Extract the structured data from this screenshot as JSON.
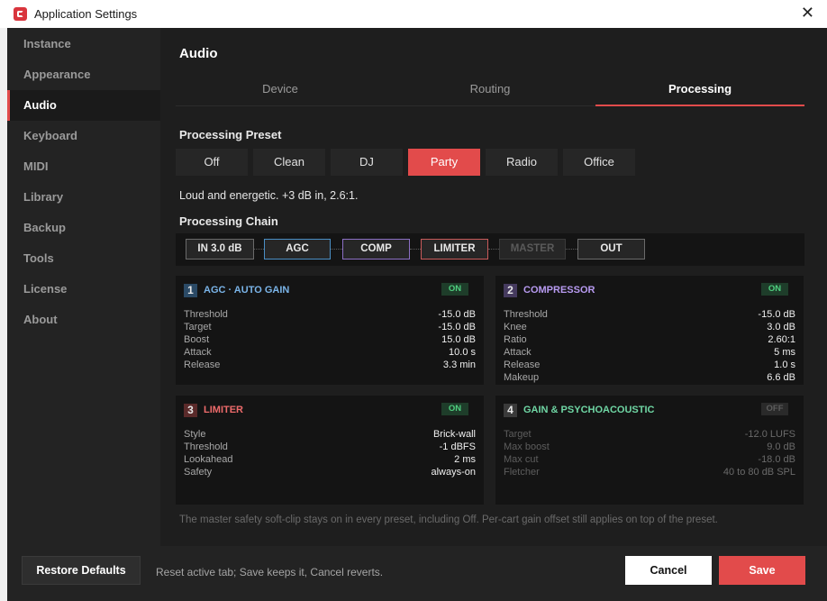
{
  "window": {
    "title": "Application Settings",
    "icon": "app-logo-icon",
    "close_glyph": "✕"
  },
  "sidebar": {
    "items": [
      {
        "label": "Instance"
      },
      {
        "label": "Appearance"
      },
      {
        "label": "Audio",
        "active": true
      },
      {
        "label": "Keyboard"
      },
      {
        "label": "MIDI"
      },
      {
        "label": "Library"
      },
      {
        "label": "Backup"
      },
      {
        "label": "Tools"
      },
      {
        "label": "License"
      },
      {
        "label": "About"
      }
    ]
  },
  "main": {
    "title": "Audio",
    "tabs": [
      {
        "label": "Device"
      },
      {
        "label": "Routing"
      },
      {
        "label": "Processing",
        "active": true
      }
    ],
    "preset_label": "Processing Preset",
    "presets": [
      {
        "label": "Off"
      },
      {
        "label": "Clean"
      },
      {
        "label": "DJ"
      },
      {
        "label": "Party",
        "active": true
      },
      {
        "label": "Radio"
      },
      {
        "label": "Office"
      }
    ],
    "preset_description": "Loud and energetic. +3 dB in, 2.6:1.",
    "chain_label": "Processing Chain",
    "chain": [
      {
        "label": "IN 3.0 dB",
        "border": "#6a6a6a",
        "color": "#e8e8e8"
      },
      {
        "label": "AGC",
        "border": "#4a8ec4",
        "color": "#e8e8e8"
      },
      {
        "label": "COMP",
        "border": "#8b6fc4",
        "color": "#e8e8e8"
      },
      {
        "label": "LIMITER",
        "border": "#c85a5a",
        "color": "#e8e8e8"
      },
      {
        "label": "MASTER",
        "border": "#3a3a3a",
        "color": "#5a5a5a"
      },
      {
        "label": "OUT",
        "border": "#6a6a6a",
        "color": "#e8e8e8"
      }
    ],
    "cards": [
      {
        "num": "1",
        "title": "AGC · AUTO GAIN",
        "title_color": "#7ab4e8",
        "num_bg": "#2b4a66",
        "toggle": "ON",
        "enabled": true,
        "rows": [
          {
            "k": "Threshold",
            "v": "-15.0 dB"
          },
          {
            "k": "Target",
            "v": "-15.0 dB"
          },
          {
            "k": "Boost",
            "v": "15.0 dB"
          },
          {
            "k": "Attack",
            "v": "10.0 s"
          },
          {
            "k": "Release",
            "v": "3.3 min"
          }
        ]
      },
      {
        "num": "2",
        "title": "COMPRESSOR",
        "title_color": "#b79af0",
        "num_bg": "#453a5e",
        "toggle": "ON",
        "enabled": true,
        "rows": [
          {
            "k": "Threshold",
            "v": "-15.0 dB"
          },
          {
            "k": "Knee",
            "v": "3.0 dB"
          },
          {
            "k": "Ratio",
            "v": "2.60:1"
          },
          {
            "k": "Attack",
            "v": "5 ms"
          },
          {
            "k": "Release",
            "v": "1.0 s"
          },
          {
            "k": "Makeup",
            "v": "6.6 dB"
          }
        ]
      },
      {
        "num": "3",
        "title": "LIMITER",
        "title_color": "#ee6b6b",
        "num_bg": "#5a2a2a",
        "toggle": "ON",
        "enabled": true,
        "rows": [
          {
            "k": "Style",
            "v": "Brick-wall"
          },
          {
            "k": "Threshold",
            "v": "-1 dBFS"
          },
          {
            "k": "Lookahead",
            "v": "2 ms"
          },
          {
            "k": "Safety",
            "v": "always-on"
          }
        ]
      },
      {
        "num": "4",
        "title": "GAIN & PSYCHOACOUSTIC",
        "title_color": "#6fd6a4",
        "num_bg": "#3a3a3a",
        "toggle": "OFF",
        "enabled": false,
        "rows": [
          {
            "k": "Target",
            "v": "-12.0 LUFS"
          },
          {
            "k": "Max boost",
            "v": "9.0 dB"
          },
          {
            "k": "Max cut",
            "v": "-18.0 dB"
          },
          {
            "k": "Fletcher",
            "v": "40 to 80 dB SPL"
          }
        ]
      }
    ],
    "footnote": "The master safety soft-clip stays on in every preset, including Off. Per-cart gain offset still applies on top of the preset."
  },
  "footer": {
    "restore_label": "Restore Defaults",
    "hint": "Reset active tab; Save keeps it, Cancel reverts.",
    "cancel_label": "Cancel",
    "save_label": "Save"
  },
  "colors": {
    "accent": "#e24b4b",
    "toggle_on_bg": "#1e3d2a",
    "toggle_on_text": "#4fcf7f",
    "toggle_off_bg": "#2a2a2a",
    "toggle_off_text": "#5d5d5d"
  }
}
